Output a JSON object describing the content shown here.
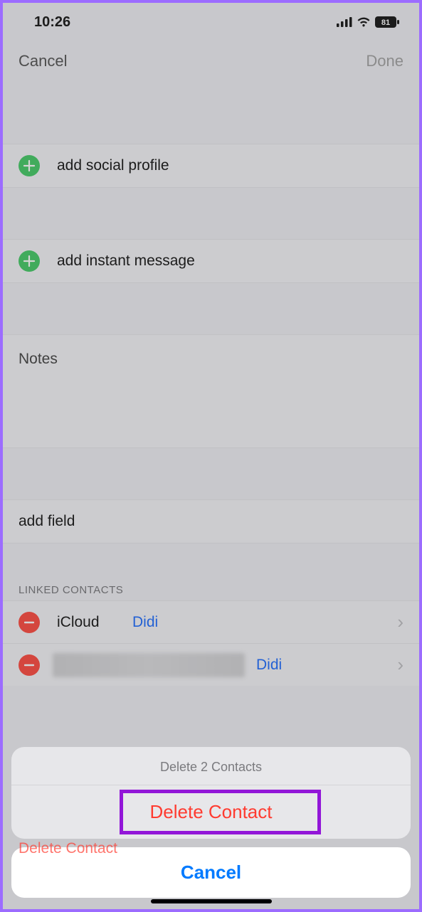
{
  "status": {
    "time": "10:26",
    "battery": "81"
  },
  "nav": {
    "cancel": "Cancel",
    "done": "Done"
  },
  "rows": {
    "add_social": "add social profile",
    "add_im": "add instant message",
    "notes_label": "Notes",
    "add_field": "add field"
  },
  "linked": {
    "header": "LINKED CONTACTS",
    "items": [
      {
        "account": "iCloud",
        "name": "Didi"
      },
      {
        "account": "",
        "name": "Didi"
      }
    ]
  },
  "delete_row": "Delete Contact",
  "sheet": {
    "title": "Delete 2 Contacts",
    "destructive": "Delete Contact",
    "cancel": "Cancel"
  }
}
